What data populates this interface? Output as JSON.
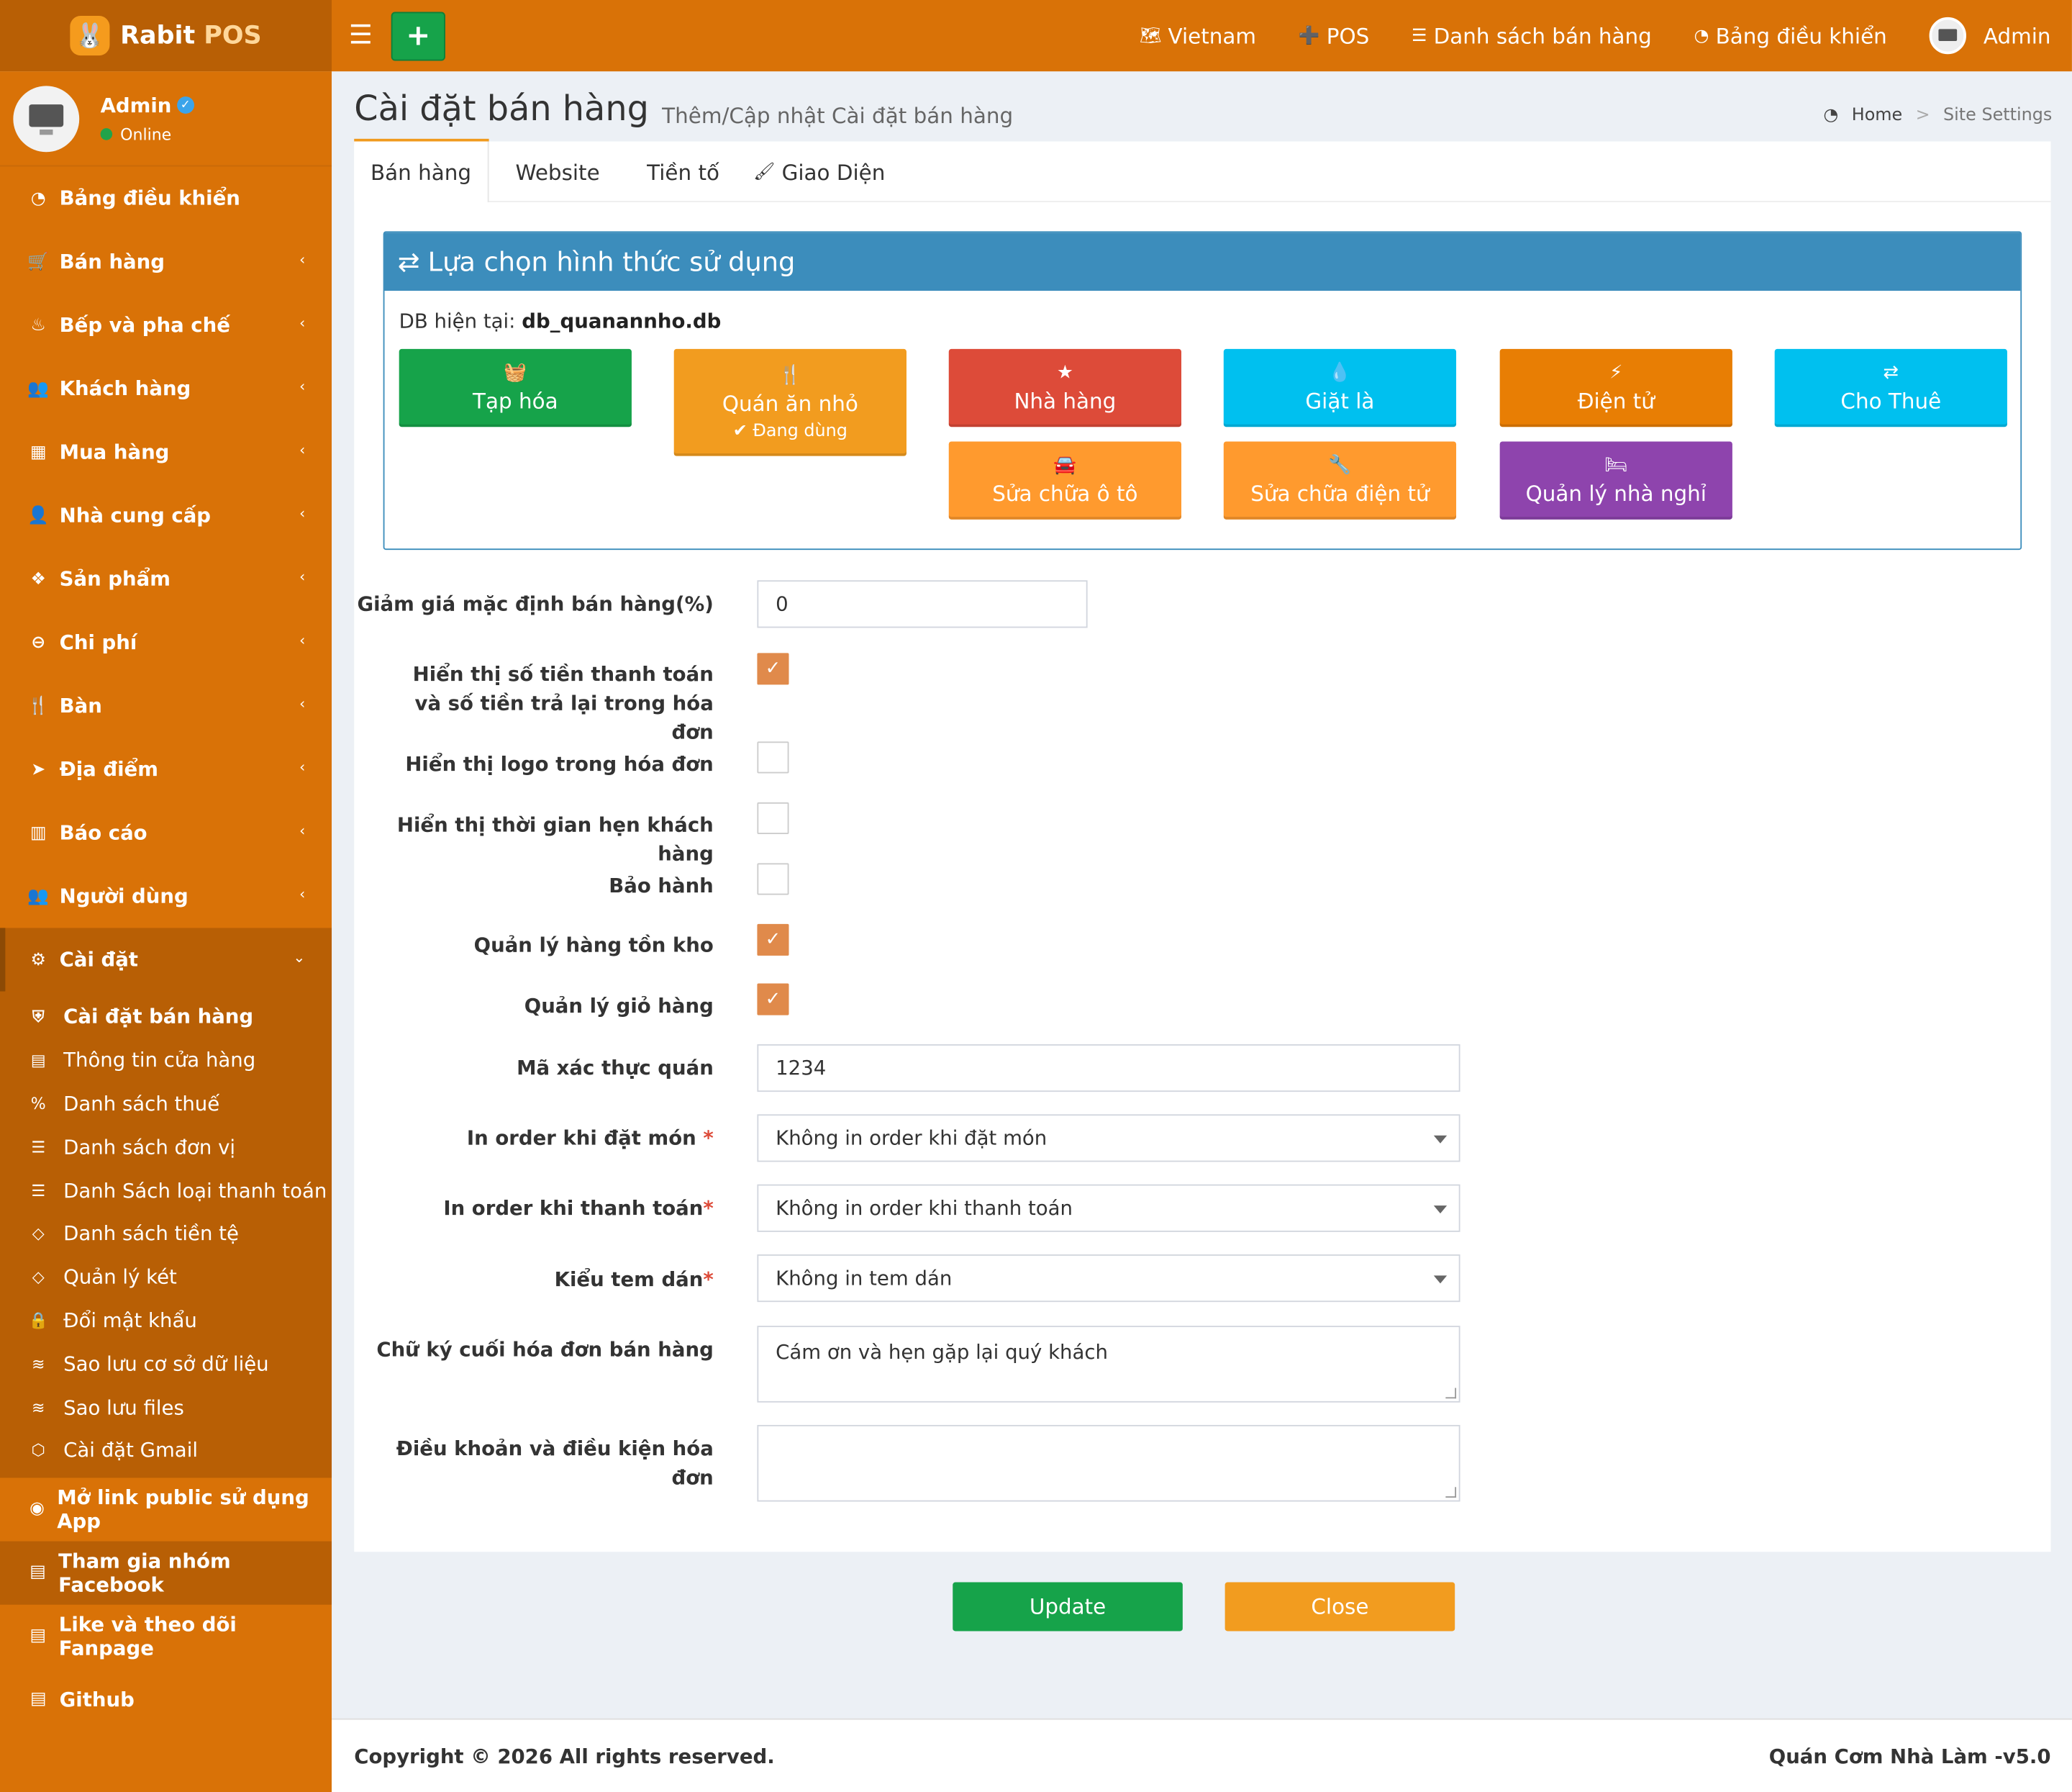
{
  "app": {
    "logo_glyph": "🐰",
    "name": "Rabit",
    "name_suffix": "POS"
  },
  "topnav": {
    "plus_label": "+",
    "items": [
      {
        "icon": "map-icon",
        "glyph": "🗺",
        "label": "Vietnam"
      },
      {
        "icon": "plus-square-icon",
        "glyph": "➕",
        "label": "POS"
      },
      {
        "icon": "list-icon",
        "glyph": "☰",
        "label": "Danh sách bán hàng"
      },
      {
        "icon": "dashboard-icon",
        "glyph": "◔",
        "label": "Bảng điều khiển"
      }
    ],
    "admin_label": "Admin"
  },
  "user": {
    "name": "Admin",
    "verified_glyph": "✓",
    "status": "Online"
  },
  "sidebar": {
    "items": [
      {
        "icon": "dashboard-icon",
        "glyph": "◔",
        "label": "Bảng điều khiển",
        "has_children": false
      },
      {
        "icon": "cart-icon",
        "glyph": "🛒",
        "label": "Bán hàng",
        "has_children": true
      },
      {
        "icon": "chef-icon",
        "glyph": "♨",
        "label": "Bếp và pha chế",
        "has_children": true
      },
      {
        "icon": "users-icon",
        "glyph": "👥",
        "label": "Khách hàng",
        "has_children": true
      },
      {
        "icon": "grid-icon",
        "glyph": "▦",
        "label": "Mua hàng",
        "has_children": true
      },
      {
        "icon": "user-plus-icon",
        "glyph": "👤",
        "label": "Nhà cung cấp",
        "has_children": true
      },
      {
        "icon": "cubes-icon",
        "glyph": "❖",
        "label": "Sản phẩm",
        "has_children": true
      },
      {
        "icon": "minus-circle-icon",
        "glyph": "⊖",
        "label": "Chi phí",
        "has_children": true
      },
      {
        "icon": "utensils-icon",
        "glyph": "🍴",
        "label": "Bàn",
        "has_children": true
      },
      {
        "icon": "location-arrow-icon",
        "glyph": "➤",
        "label": "Địa điểm",
        "has_children": true
      },
      {
        "icon": "bar-chart-icon",
        "glyph": "▥",
        "label": "Báo cáo",
        "has_children": true
      },
      {
        "icon": "users-icon",
        "glyph": "👥",
        "label": "Người dùng",
        "has_children": true
      },
      {
        "icon": "cogs-icon",
        "glyph": "⚙",
        "label": "Cài đặt",
        "has_children": true
      }
    ],
    "settings_sub": [
      {
        "icon": "shield-icon",
        "glyph": "⛨",
        "label": "Cài đặt bán hàng"
      },
      {
        "icon": "briefcase-icon",
        "glyph": "▤",
        "label": "Thông tin cửa hàng"
      },
      {
        "icon": "percent-icon",
        "glyph": "%",
        "label": "Danh sách thuế"
      },
      {
        "icon": "list-icon",
        "glyph": "☰",
        "label": "Danh sách đơn vị"
      },
      {
        "icon": "list-icon",
        "glyph": "☰",
        "label": "Danh Sách loại thanh toán"
      },
      {
        "icon": "code-icon",
        "glyph": "◇",
        "label": "Danh sách tiền tệ"
      },
      {
        "icon": "code-icon",
        "glyph": "◇",
        "label": "Quản lý két"
      },
      {
        "icon": "lock-icon",
        "glyph": "🔒",
        "label": "Đổi mật khẩu"
      },
      {
        "icon": "database-icon",
        "glyph": "≋",
        "label": "Sao lưu cơ sở dữ liệu"
      },
      {
        "icon": "database-icon",
        "glyph": "≋",
        "label": "Sao lưu files"
      },
      {
        "icon": "cube-icon",
        "glyph": "⬡",
        "label": "Cài đặt Gmail"
      }
    ],
    "extra": [
      {
        "icon": "globe-icon",
        "glyph": "◉",
        "label": "Mở link public sử dụng App"
      },
      {
        "icon": "briefcase-icon",
        "glyph": "▤",
        "label": "Tham gia nhóm Facebook"
      },
      {
        "icon": "briefcase-icon",
        "glyph": "▤",
        "label": "Like và theo dõi Fanpage"
      },
      {
        "icon": "briefcase-icon",
        "glyph": "▤",
        "label": "Github"
      }
    ]
  },
  "header": {
    "title": "Cài đặt bán hàng",
    "subtitle": "Thêm/Cập nhật Cài đặt bán hàng",
    "breadcrumb_home_glyph": "◔",
    "breadcrumb_home": "Home",
    "breadcrumb_sep": ">",
    "breadcrumb_current": "Site Settings"
  },
  "tabs": [
    {
      "label": "Bán hàng",
      "active": true
    },
    {
      "label": "Website",
      "active": false
    },
    {
      "label": "Tiền tố",
      "active": false
    },
    {
      "label": "Giao Diện",
      "active": false,
      "glyph": "🖌"
    }
  ],
  "panel": {
    "title_glyph": "⇄",
    "title": "Lựa chọn hình thức sử dụng",
    "db_label": "DB hiện tại:",
    "db_name": "db_quanannho.db",
    "modes": [
      {
        "icon": "basket-icon",
        "glyph": "🧺",
        "label": "Tạp hóa",
        "color": "#16a34a"
      },
      {
        "icon": "utensils-icon",
        "glyph": "🍴",
        "label": "Quán ăn nhỏ",
        "color": "#f29c1f",
        "active_label": "✔ Đang dùng"
      },
      {
        "icon": "star-icon",
        "glyph": "★",
        "label": "Nhà hàng",
        "color": "#dd4b39"
      },
      {
        "icon": "tint-icon",
        "glyph": "💧",
        "label": "Giặt là",
        "color": "#00c0ef"
      },
      {
        "icon": "bolt-icon",
        "glyph": "⚡",
        "label": "Điện tử",
        "color": "#e87e04"
      },
      {
        "icon": "exchange-icon",
        "glyph": "⇄",
        "label": "Cho Thuê",
        "color": "#00c0ef"
      },
      {
        "icon": "car-icon",
        "glyph": "🚘",
        "label": "Sửa chữa ô tô",
        "color": "#ff9a2e"
      },
      {
        "icon": "wrench-icon",
        "glyph": "🔧",
        "label": "Sửa chữa điện tử",
        "color": "#ff9a2e"
      },
      {
        "icon": "bed-icon",
        "glyph": "🛏",
        "label": "Quản lý nhà nghỉ",
        "color": "#8e44ad"
      }
    ]
  },
  "form": {
    "discount_label": "Giảm giá mặc định bán hàng(%)",
    "discount_value": "0",
    "show_payment_label": "Hiển thị số tiền thanh toán và số tiền trả lại trong hóa đơn",
    "show_payment_checked": true,
    "show_logo_label": "Hiển thị logo trong hóa đơn",
    "show_logo_checked": false,
    "show_time_label": "Hiển thị thời gian hẹn khách hàng",
    "show_time_checked": false,
    "warranty_label": "Bảo hành",
    "warranty_checked": false,
    "inventory_label": "Quản lý hàng tồn kho",
    "inventory_checked": true,
    "cart_label": "Quản lý giỏ hàng",
    "cart_checked": true,
    "check_glyph": "✓",
    "auth_code_label": "Mã xác thực quán",
    "auth_code_value": "1234",
    "print_order_label": "In order khi đặt món",
    "print_order_value": "Không in order khi đặt món",
    "print_payment_label": "In order khi thanh toán",
    "print_payment_value": "Không in order khi thanh toán",
    "sticker_label": "Kiểu tem dán",
    "sticker_value": "Không in tem dán",
    "required_mark": "*",
    "signature_label": "Chữ ký cuối hóa đơn bán hàng",
    "signature_value": "Cám ơn và hẹn gặp lại quý khách",
    "terms_label": "Điều khoản và điều kiện hóa đơn",
    "terms_value": ""
  },
  "actions": {
    "update": "Update",
    "close": "Close",
    "update_color": "#16a34a",
    "close_color": "#f29c1f"
  },
  "footer": {
    "copyright": "Copyright © 2026 All rights reserved.",
    "app_version": "Quán Cơm Nhà Làm -v5.0"
  }
}
